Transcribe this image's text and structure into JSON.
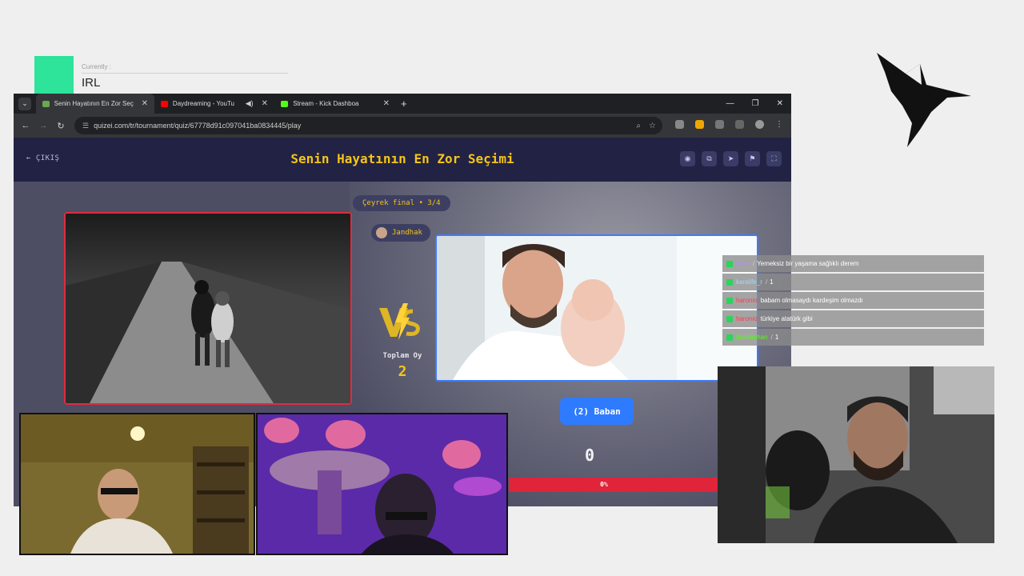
{
  "overlay": {
    "currently_label": "Currently :",
    "category": "IRL",
    "accent_color": "#2ee39a"
  },
  "browser": {
    "tabs": [
      {
        "title": "Senin Hayatının En Zor Seçimi -",
        "favicon_color": "#6aa84f",
        "active": true
      },
      {
        "title": "Daydreaming - YouTube",
        "favicon_color": "#ff0000",
        "active": false,
        "audio": true
      },
      {
        "title": "Stream - Kick Dashboard",
        "favicon_color": "#53fc18",
        "active": false
      }
    ],
    "url": "quizei.com/tr/tournament/quiz/67778d91c097041ba0834445/play"
  },
  "quiz": {
    "exit_label": "ÇIKIŞ",
    "title": "Senin Hayatının En Zor Seçimi",
    "round_label": "Çeyrek final • 3/4",
    "host_name": "Jandhak",
    "total_votes_label": "Toplam Oy",
    "total_votes_value": "2",
    "right_choice_label": "(2) Baban",
    "right_count": "0",
    "right_percent_label": "0%",
    "title_color": "#f5c518",
    "left_border_color": "#e02b3e",
    "right_border_color": "#3d7cff"
  },
  "chat": [
    {
      "user": "lotus",
      "badge": "/",
      "message": "Yemeksiz bir yaşama sağlıklı derem",
      "user_color": "#b98aff"
    },
    {
      "user": "karalife_r",
      "badge": "/",
      "message": "1",
      "user_color": "#9fd6ff"
    },
    {
      "user": "haronio",
      "badge": "",
      "message": "babam olmasaydı kardeşim olmazdı",
      "user_color": "#ff3b4e"
    },
    {
      "user": "haronio",
      "badge": "",
      "message": "türkiye atatürk gibi",
      "user_color": "#ff3b4e"
    },
    {
      "user": "ibrahimhan",
      "badge": "/",
      "message": "1",
      "user_color": "#53fc18"
    }
  ]
}
